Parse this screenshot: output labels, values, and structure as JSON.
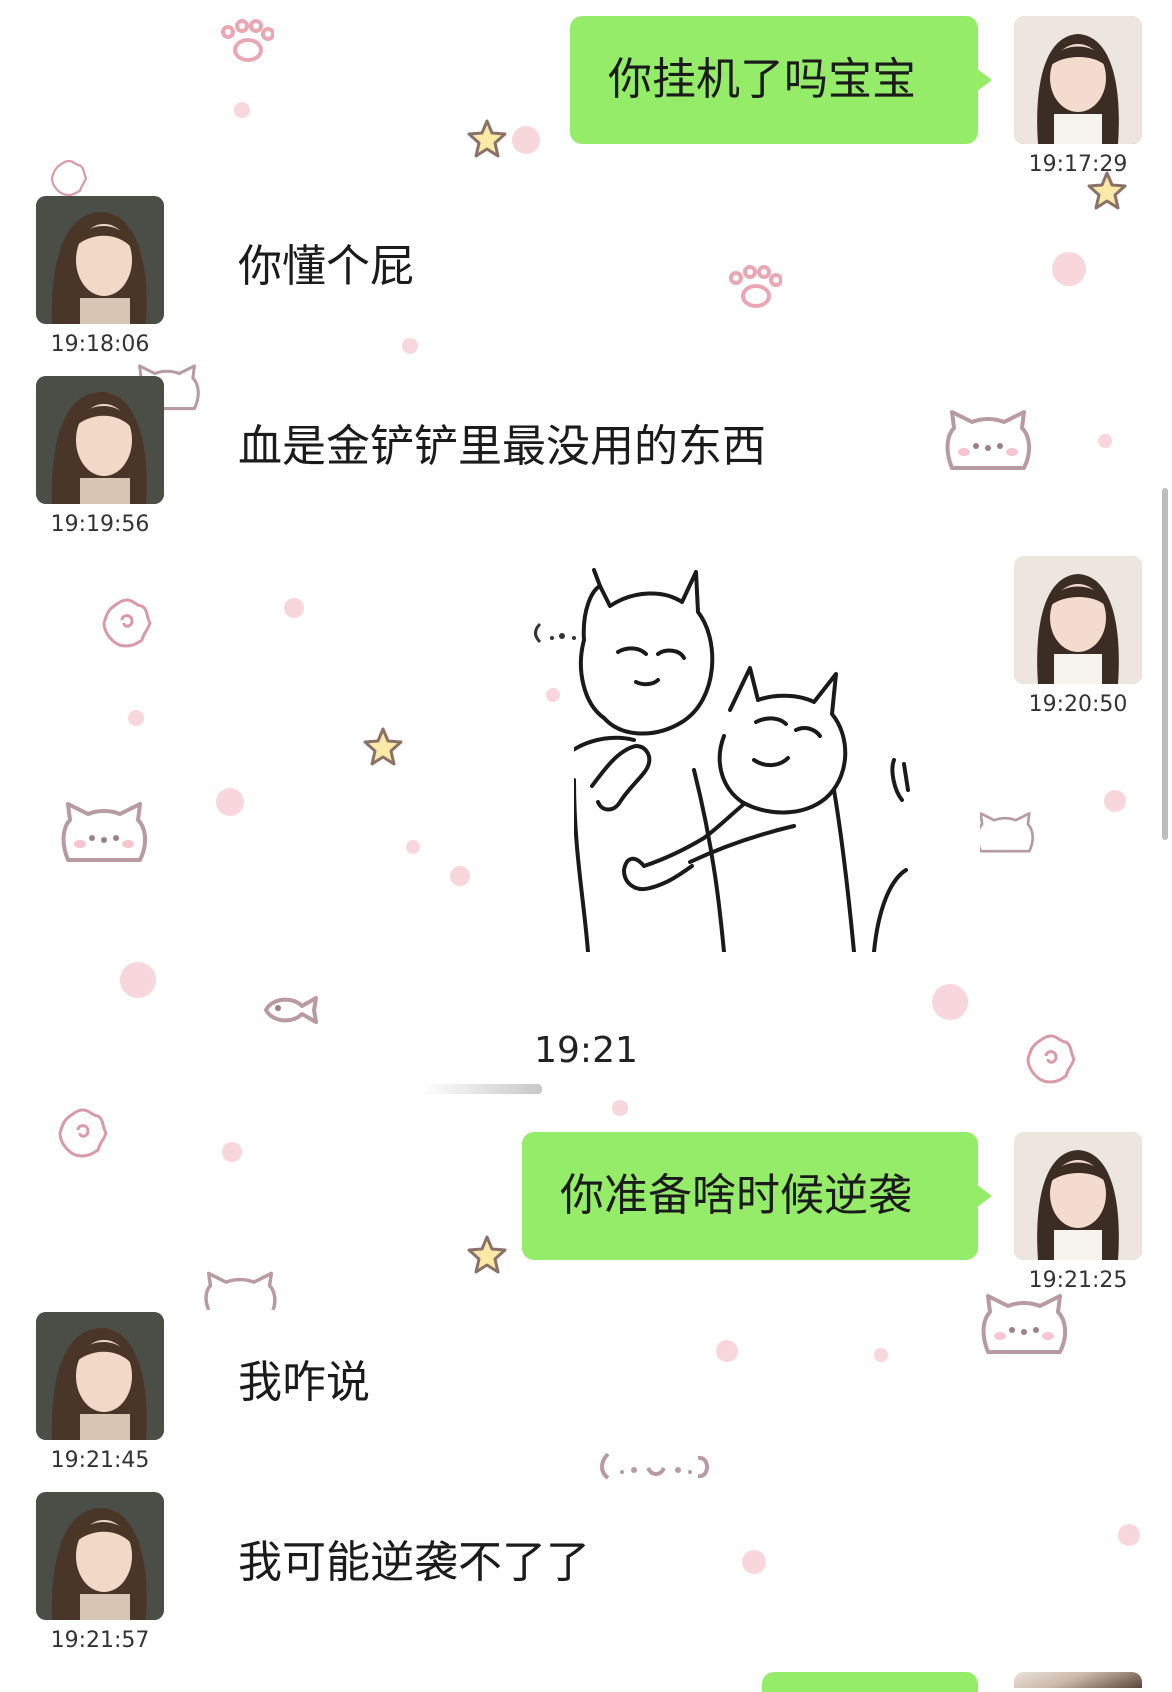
{
  "messages": [
    {
      "side": "me",
      "text": "你挂机了吗宝宝",
      "time": "19:17:29"
    },
    {
      "side": "other",
      "text": "你懂个屁",
      "time": "19:18:06"
    },
    {
      "side": "other",
      "text": "血是金铲铲里最没用的东西",
      "time": "19:19:56"
    },
    {
      "side": "me",
      "type": "sticker",
      "sticker_name": "two-cats-hugging-sticker",
      "time": "19:20:50"
    },
    {
      "side": "me",
      "text": "你准备啥时候逆袭",
      "time": "19:21:25"
    },
    {
      "side": "other",
      "text": "我咋说",
      "time": "19:21:45"
    },
    {
      "side": "other",
      "text": "我可能逆袭不了了",
      "time": "19:21:57"
    }
  ],
  "divider_time": "19:21",
  "colors": {
    "my_bubble": "#95ec69",
    "background_decor": "#f7d6dc",
    "background": "#ffffff"
  }
}
